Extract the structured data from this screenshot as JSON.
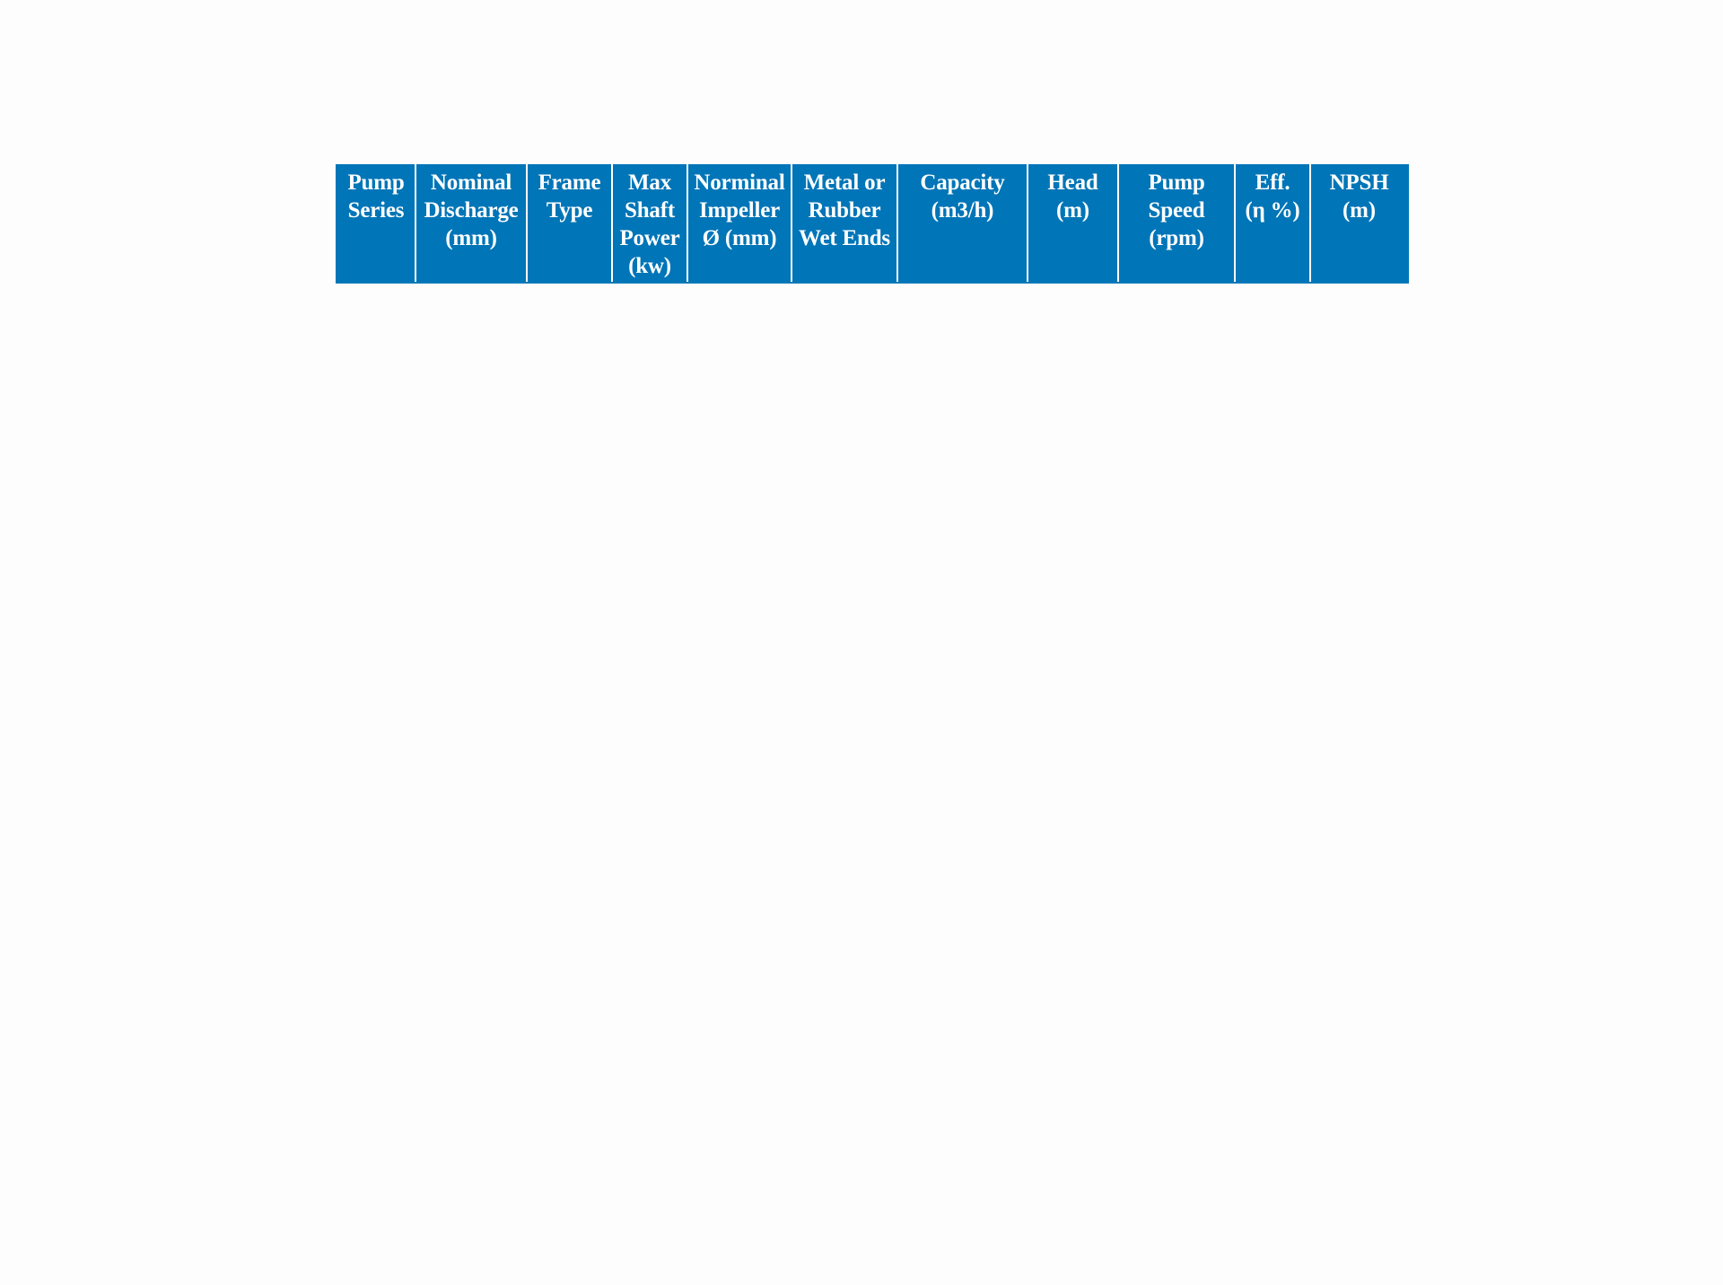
{
  "table": {
    "header_color": "#0075b7",
    "header_text_color": "#ffffff",
    "columns": [
      {
        "label": "Pump\nSeries"
      },
      {
        "label": "Nominal\nDischarge\n(mm)"
      },
      {
        "label": "Frame\nType"
      },
      {
        "label": "Max\nShaft\nPower\n(kw)"
      },
      {
        "label": "Norminal\nImpeller\nØ (mm)"
      },
      {
        "label": "Metal or\nRubber\nWet Ends"
      },
      {
        "label": "Capacity\n(m3/h)"
      },
      {
        "label": "Head\n(m)"
      },
      {
        "label": "Pump\nSpeed\n(rpm)"
      },
      {
        "label": "Eff.\n(η %)"
      },
      {
        "label": "NPSH\n(m)"
      }
    ],
    "rows": []
  }
}
